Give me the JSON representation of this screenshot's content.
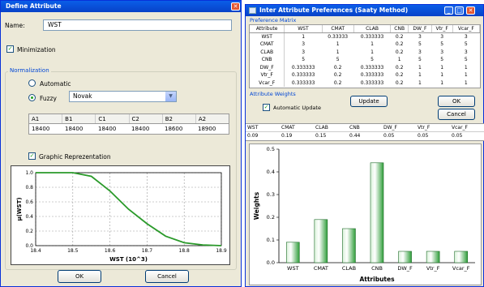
{
  "left": {
    "title": "Define Attribute",
    "name_label": "Name:",
    "name_value": "WST",
    "minimization": "Minimization",
    "normalization": "Normalization",
    "automatic": "Automatic",
    "fuzzy": "Fuzzy",
    "fuzzy_select": "Novak",
    "param_headers": [
      "A1",
      "B1",
      "C1",
      "C2",
      "B2",
      "A2"
    ],
    "param_values": [
      "18400",
      "18400",
      "18400",
      "18400",
      "18600",
      "18900"
    ],
    "graphic": "Graphic Reprezentation",
    "ok": "OK",
    "cancel": "Cancel"
  },
  "left_chart": {
    "chart_data": {
      "type": "line",
      "xlabel": "WST (10^3)",
      "ylabel": "μ(WST)",
      "x_ticks": [
        "18.4",
        "18.5",
        "18.6",
        "18.7",
        "18.8",
        "18.9"
      ],
      "y_ticks": [
        "0.0",
        "0.2",
        "0.4",
        "0.6",
        "0.8",
        "1.0"
      ],
      "xlim": [
        18.4,
        18.9
      ],
      "ylim": [
        0,
        1
      ],
      "grid": true,
      "points": [
        [
          18.4,
          1.0
        ],
        [
          18.5,
          1.0
        ],
        [
          18.55,
          0.95
        ],
        [
          18.6,
          0.75
        ],
        [
          18.65,
          0.5
        ],
        [
          18.7,
          0.3
        ],
        [
          18.75,
          0.13
        ],
        [
          18.8,
          0.04
        ],
        [
          18.85,
          0.01
        ],
        [
          18.9,
          0.0
        ]
      ],
      "color": "#2a9a2a"
    }
  },
  "right": {
    "title": "Inter Attribute Preferences (Saaty Method)",
    "matrix_label": "Preference Matrix",
    "headers": [
      "Attribute",
      "WST",
      "CMAT",
      "CLAB",
      "CNB",
      "DW_F",
      "Vtr_F",
      "Vcar_F"
    ],
    "rows": [
      [
        "WST",
        "1",
        "0.33333",
        "0.333333",
        "0.2",
        "3",
        "3",
        "3"
      ],
      [
        "CMAT",
        "3",
        "1",
        "1",
        "0.2",
        "5",
        "5",
        "5"
      ],
      [
        "CLAB",
        "3",
        "1",
        "1",
        "0.2",
        "3",
        "3",
        "3"
      ],
      [
        "CNB",
        "5",
        "5",
        "5",
        "1",
        "5",
        "5",
        "5"
      ],
      [
        "DW_F",
        "0.333333",
        "0.2",
        "0.333333",
        "0.2",
        "1",
        "1",
        "1"
      ],
      [
        "Vtr_F",
        "0.333333",
        "0.2",
        "0.333333",
        "0.2",
        "1",
        "1",
        "1"
      ],
      [
        "Vcar_F",
        "0.333333",
        "0.2",
        "0.333333",
        "0.2",
        "1",
        "1",
        "1"
      ]
    ],
    "weights_label": "Attribute Weights",
    "auto_update": "Automatic Update",
    "update": "Update",
    "ok": "OK",
    "cancel": "Cancel",
    "weight_headers": [
      "WST",
      "CMAT",
      "CLAB",
      "CNB",
      "DW_F",
      "Vtr_F",
      "Vcar_F"
    ],
    "weight_values": [
      "0.09",
      "0.19",
      "0.15",
      "0.44",
      "0.05",
      "0.05",
      "0.05"
    ]
  },
  "right_chart": {
    "chart_data": {
      "type": "bar",
      "categories": [
        "WST",
        "CMAT",
        "CLAB",
        "CNB",
        "DW_F",
        "Vtr_F",
        "Vcar_F"
      ],
      "values": [
        0.09,
        0.19,
        0.15,
        0.44,
        0.05,
        0.05,
        0.05
      ],
      "xlabel": "Attributes",
      "ylabel": "Weights",
      "ylim": [
        0,
        0.5
      ],
      "y_ticks": [
        "0.0",
        "0.1",
        "0.2",
        "0.3",
        "0.4",
        "0.5"
      ],
      "color": "#2f9e3a"
    }
  }
}
